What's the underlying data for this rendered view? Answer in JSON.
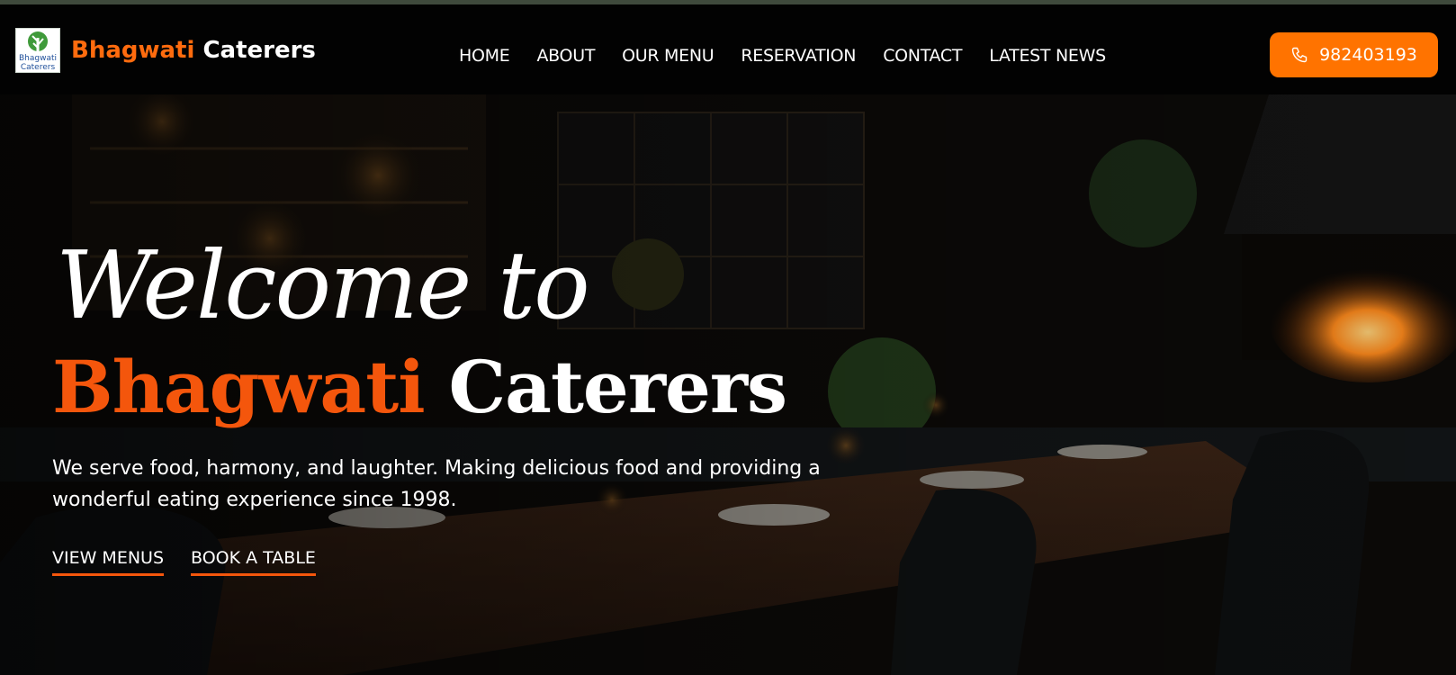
{
  "header": {
    "brand_part1": "Bhagwati",
    "brand_part2": "Caterers",
    "logo_text_line1": "Bhagwati",
    "logo_text_line2": "Caterers",
    "nav": [
      {
        "label": "HOME"
      },
      {
        "label": "ABOUT"
      },
      {
        "label": "OUR MENU"
      },
      {
        "label": "RESERVATION"
      },
      {
        "label": "CONTACT"
      },
      {
        "label": "LATEST NEWS"
      }
    ],
    "phone": "982403193",
    "phone_icon": "phone-icon"
  },
  "hero": {
    "welcome": "Welcome to",
    "title_part1": "Bhagwati",
    "title_part2": "Caterers",
    "tagline": "We serve food, harmony, and laughter. Making delicious food and providing a wonderful eating experience since 1998.",
    "cta_menus": "VIEW MENUS",
    "cta_book": "BOOK A TABLE"
  },
  "colors": {
    "accent": "#ff7300",
    "headline_accent": "#f4560c",
    "header_bg": "#020202",
    "text": "#ffffff"
  }
}
